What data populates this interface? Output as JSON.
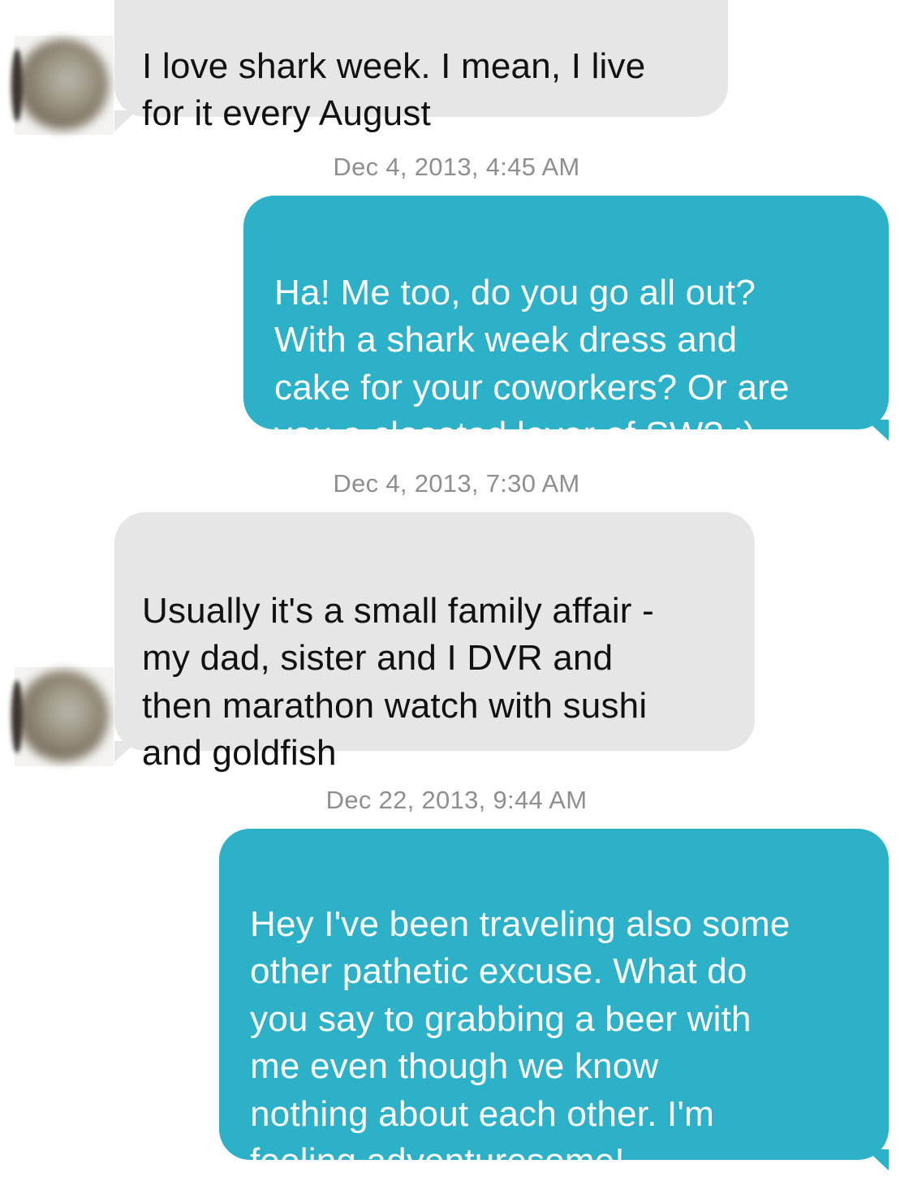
{
  "messages": [
    {
      "kind": "incoming",
      "text": "I love shark week. I mean, I live\nfor it every August"
    },
    {
      "kind": "timestamp",
      "text": "Dec 4, 2013, 4:45 AM"
    },
    {
      "kind": "outgoing",
      "text": "Ha! Me too, do you go all out?\nWith a shark week dress and\ncake for your coworkers? Or are\nyou a closeted lover of SW? :)"
    },
    {
      "kind": "timestamp",
      "text": "Dec 4, 2013, 7:30 AM"
    },
    {
      "kind": "incoming",
      "text": "Usually it's a small family affair -\nmy dad, sister and I DVR and\nthen marathon watch with sushi\nand goldfish"
    },
    {
      "kind": "timestamp",
      "text": "Dec 22, 2013, 9:44 AM"
    },
    {
      "kind": "outgoing",
      "text": "Hey I've been traveling also some\nother pathetic excuse. What do\nyou say to grabbing a beer with\nme even though we know\nnothing about each other. I'm\nfeeling adventuresome!"
    }
  ],
  "colors": {
    "incoming_bubble": "#e6e6e6",
    "outgoing_bubble": "#2cb1c9",
    "timestamp_text": "#8e8e93"
  },
  "icons": {
    "contact_avatar": "blurred-avatar-icon"
  }
}
